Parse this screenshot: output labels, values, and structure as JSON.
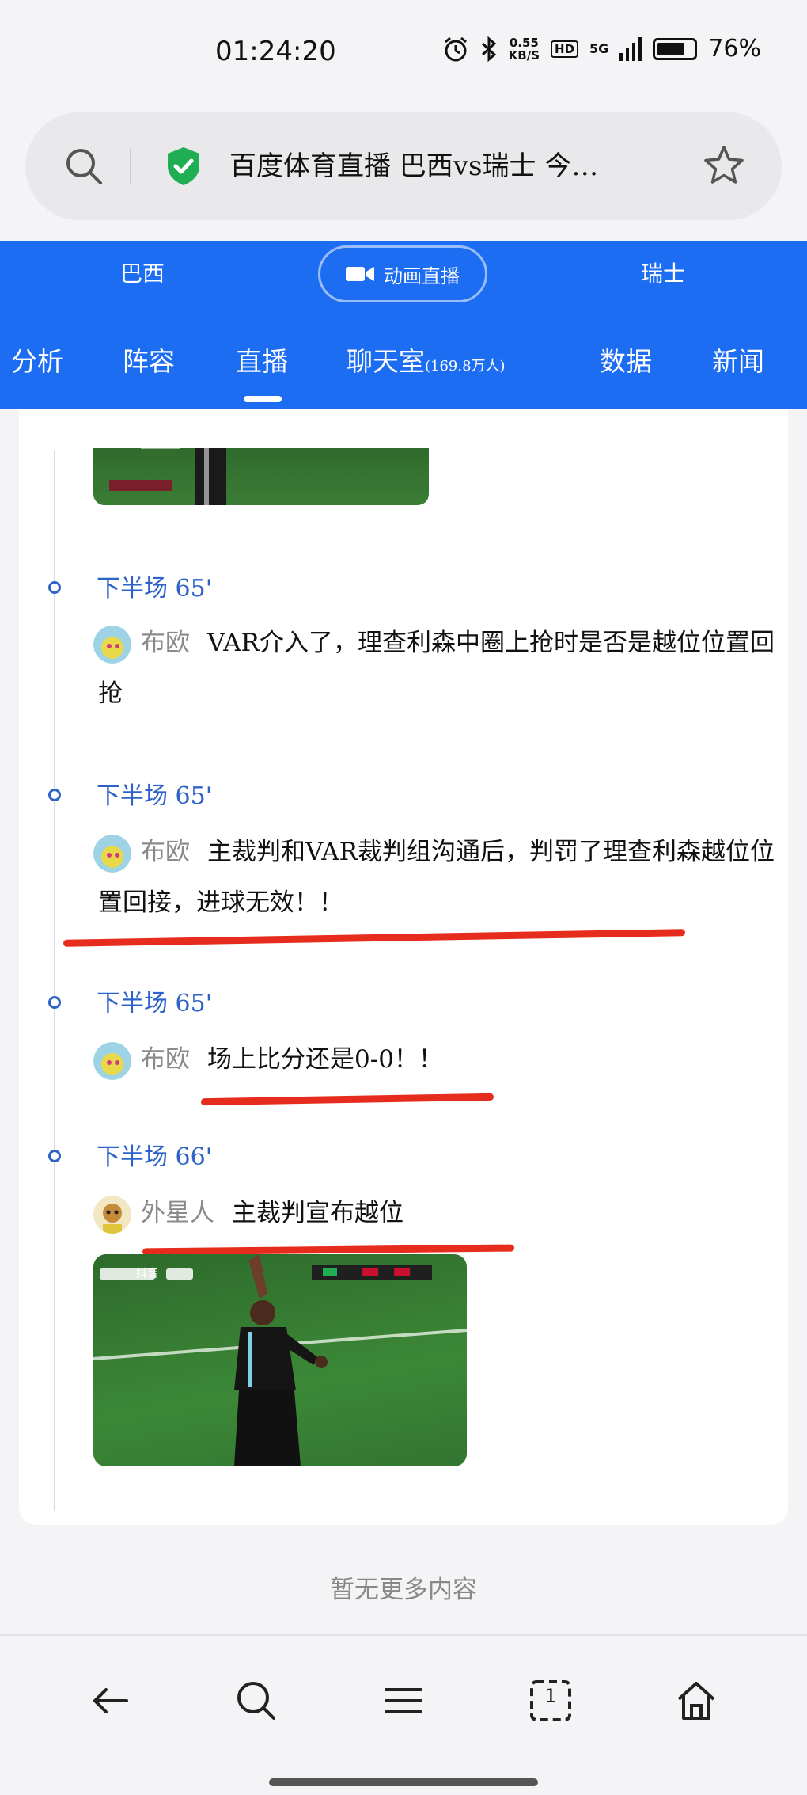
{
  "status_bar": {
    "time": "01:24:20",
    "net_speed_value": "0.55",
    "net_speed_unit": "KB/S",
    "hd": "HD",
    "network": "5G",
    "battery": "76%",
    "battery_level": 0.76
  },
  "search_bar": {
    "title": "百度体育直播 巴西vs瑞士 今…"
  },
  "match_header": {
    "home_team": "巴西",
    "away_team": "瑞士",
    "animation_button": "动画直播",
    "tabs": [
      {
        "label": "分析"
      },
      {
        "label": "阵容"
      },
      {
        "label": "直播",
        "active": true
      },
      {
        "label": "聊天室",
        "extra": "(169.8万人)"
      },
      {
        "label": "数据"
      },
      {
        "label": "新闻"
      }
    ]
  },
  "live_feed": [
    {
      "minute": "下半场 65'",
      "author": "布欧",
      "text": "VAR介入了，理查利森中圈上抢时是否是越位位置回抢"
    },
    {
      "minute": "下半场 65'",
      "author": "布欧",
      "text": "主裁判和VAR裁判组沟通后，判罚了理查利森越位位置回接，进球无效！！"
    },
    {
      "minute": "下半场 65'",
      "author": "布欧",
      "text": "场上比分还是0-0！！"
    },
    {
      "minute": "下半场 66'",
      "author": "外星人",
      "text": "主裁判宣布越位"
    }
  ],
  "photo_overlay": {
    "brand": "抖音"
  },
  "footer": {
    "no_more": "暂无更多内容"
  },
  "bottom_nav": {
    "tab_count": "1"
  },
  "colors": {
    "brand_blue": "#1d6df3",
    "timeline_blue": "#2d62c8",
    "annotation_red": "#e62c1c"
  }
}
